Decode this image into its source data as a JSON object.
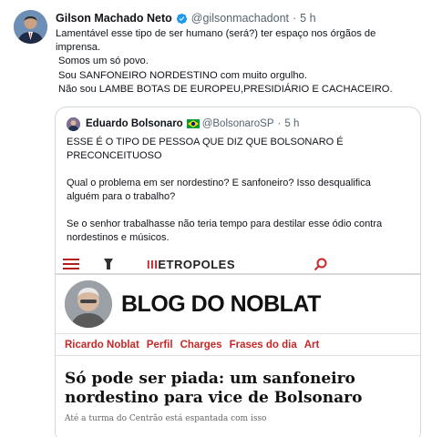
{
  "tweet": {
    "author_name": "Gilson Machado Neto",
    "handle": "@gilsonmachadont",
    "separator": "·",
    "time": "5 h",
    "lines": [
      "Lamentável esse tipo de ser humano (será?) ter espaço nos órgãos de",
      "imprensa.",
      "Somos um só povo.",
      "Sou SANFONEIRO NORDESTINO com muito orgulho.",
      "Não sou LAMBE BOTAS DE EUROPEU,PRESIDIÁRIO E CACHACEIRO."
    ],
    "verified_color": "#1d9bf0"
  },
  "quote": {
    "author_name": "Eduardo Bolsonaro",
    "handle": "@BolsonaroSP",
    "separator": "·",
    "time": "5 h",
    "paragraph1": [
      "ESSE É O TIPO DE PESSOA QUE DIZ QUE BOLSONARO É",
      "PRECONCEITUOSO"
    ],
    "paragraph2": [
      "Qual o problema em ser nordestino? E sanfoneiro? Isso desqualifica",
      "alguém para o trabalho?"
    ],
    "paragraph3": [
      "Se o senhor trabalhasse não teria tempo para destilar esse ódio contra",
      "nordestinos e músicos."
    ]
  },
  "news": {
    "brand_mark": "III",
    "brand_name": "ETROPOLES",
    "blog_title": "BLOG DO NOBLAT",
    "nav": [
      "Ricardo Noblat",
      "Perfil",
      "Charges",
      "Frases do dia",
      "Art"
    ],
    "headline": [
      "Só pode ser piada: um sanfoneiro",
      "nordestino para vice de Bolsonaro"
    ],
    "subline": "Até a turma do Centrão está espantada com isso",
    "accent_color": "#c62828"
  }
}
